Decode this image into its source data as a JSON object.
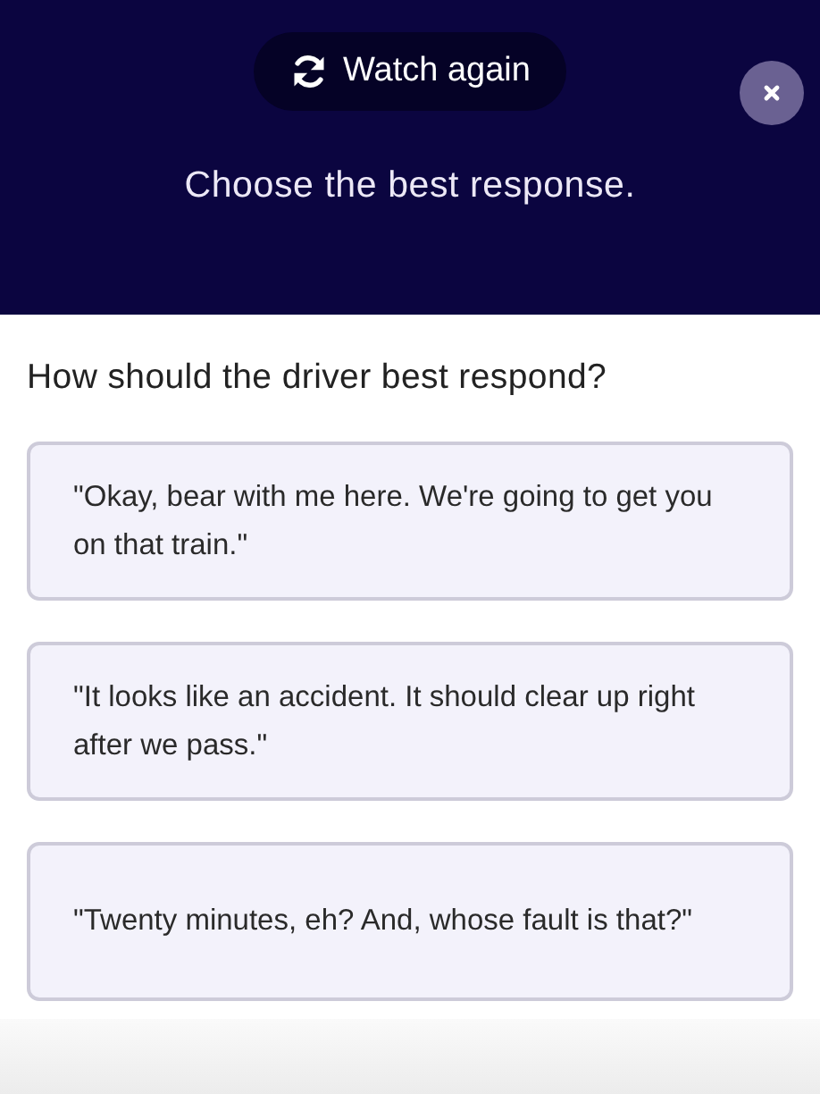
{
  "header": {
    "watch_again": "Watch again",
    "prompt": "Choose the best response."
  },
  "question": "How should the driver best respond?",
  "options": [
    {
      "text": "\"Okay, bear with me here. We're going to get you on that train.\""
    },
    {
      "text": "\"It looks like an accident. It should clear up right after we pass.\""
    },
    {
      "text": "\"Twenty minutes, eh? And, whose fault is that?\""
    }
  ]
}
